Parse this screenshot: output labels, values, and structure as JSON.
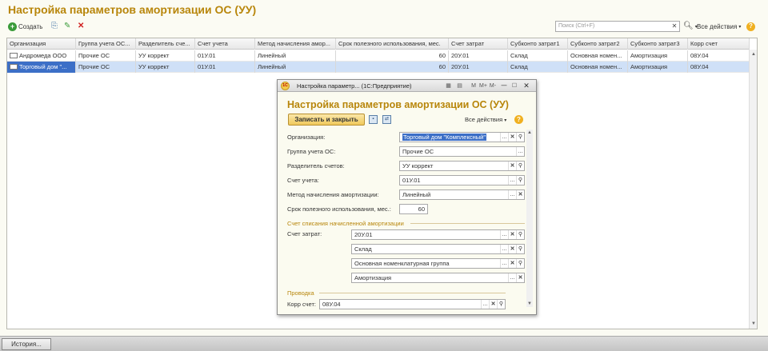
{
  "window": {
    "title": "Настройка параметров амортизации ОС (УУ)"
  },
  "toolbar": {
    "create_label": "Создать",
    "search_placeholder": "Поиск (Ctrl+F)",
    "all_actions_label": "Все действия"
  },
  "table": {
    "columns": [
      "Организация",
      "Группа учета ОС...",
      "Разделитель сче...",
      "Счет учета",
      "Метод начисления амор...",
      "Срок полезного использования, мес.",
      "Счет затрат",
      "Субконто затрат1",
      "Субконто затрат2",
      "Субконто затрат3",
      "Корр счет"
    ],
    "rows": [
      [
        "Андромеда ООО",
        "Прочие ОС",
        "УУ коррект",
        "01У.01",
        "Линейный",
        "60",
        "20У.01",
        "Склад",
        "Основная номен...",
        "Амортизация",
        "08У.04"
      ],
      [
        "Торговый дом \"...",
        "Прочие ОС",
        "УУ коррект",
        "01У.01",
        "Линейный",
        "60",
        "20У.01",
        "Склад",
        "Основная номен...",
        "Амортизация",
        "08У.04"
      ]
    ]
  },
  "statusbar": {
    "history_label": "История..."
  },
  "dialog": {
    "titlebar": "Настройка параметр... (1С:Предприятие)",
    "tb_buttons": [
      "M",
      "M+",
      "M-"
    ],
    "heading": "Настройка параметров амортизации ОС (УУ)",
    "save_close_label": "Записать и закрыть",
    "all_actions_label": "Все действия",
    "fields": {
      "org_label": "Организация:",
      "org_value": "Торговый дом \"Комплексный\"",
      "group_label": "Группа учета ОС:",
      "group_value": "Прочие ОС",
      "sep_label": "Разделитель счетов:",
      "sep_value": "УУ коррект",
      "account_label": "Счет учета:",
      "account_value": "01У.01",
      "method_label": "Метод начисления амортизации:",
      "method_value": "Линейный",
      "term_label": "Срок полезного использования, мес.:",
      "term_value": "60"
    },
    "section1": "Счет списания начисленной амортизации",
    "cost_label": "Счет затрат:",
    "cost_values": [
      "20У.01",
      "Склад",
      "Основная номенклатурная группа",
      "Амортизация"
    ],
    "section2": "Проводка",
    "corr_label": "Корр счет:",
    "corr_value": "08У.04"
  }
}
